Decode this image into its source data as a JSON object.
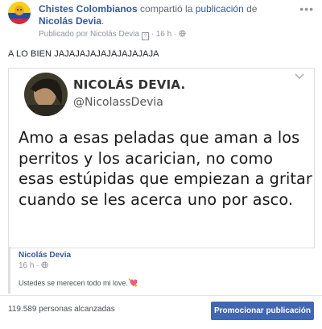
{
  "header": {
    "page_name": "Chistes Colombianos",
    "shared_verb": " compartió la ",
    "publication_link": "publicación",
    "preposition": " de ",
    "author_link": "Nicolás Devia",
    "end_dot": ".",
    "published_by_label": "Publicado por ",
    "published_by_name": "Nicolás Devia",
    "time": "16 h",
    "sep": " · ",
    "more_icon": "more-dots-icon"
  },
  "post": {
    "text": "A LO BIEN JAJAJAJAJAJAJAJAJAJA"
  },
  "embed": {
    "tweet_name": "NICOLÁS DEVIA.",
    "tweet_handle": "@NicolassDevia",
    "tweet_text": "Amo a esas peladas que aman a los perritos y los acarician, no como esas estúpidas que empiezan a gritar cuando se les acerca uno por asco.",
    "chevron_icon": "chevron-down-icon"
  },
  "quote": {
    "author": "Nicolás Devia",
    "time": "16 h",
    "text": "Ustedes se merecen todo mi love."
  },
  "footer": {
    "reach": "119.589 personas alcanzadas",
    "promote_button": "Promocionar publicación"
  },
  "colors": {
    "link": "#365899",
    "button": "#4267b2",
    "muted": "#90949c"
  }
}
